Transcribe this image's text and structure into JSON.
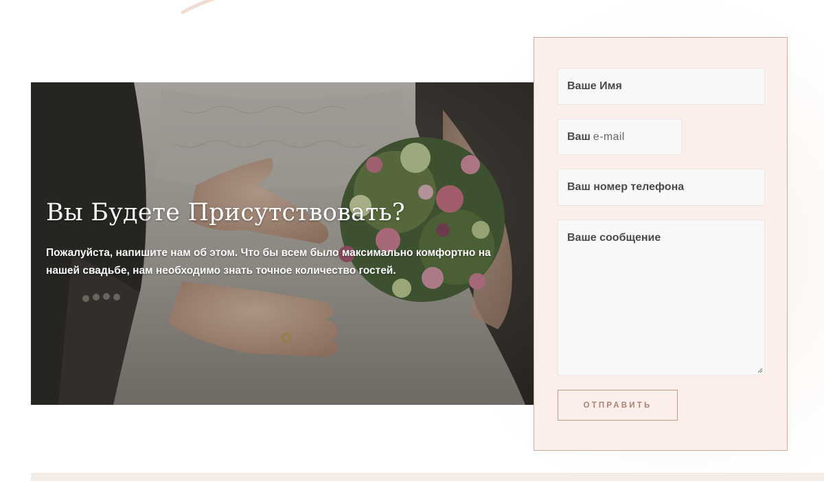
{
  "rsvp": {
    "title": "Вы Будете Присутствовать?",
    "description": "Пожалуйста, напишите нам об этом. Что бы всем было максимально комфортно на нашей свадьбе, нам необходимо знать точное количество гостей."
  },
  "form": {
    "name_placeholder": "Ваше Имя",
    "email_placeholder_bold": "Ваш",
    "email_placeholder_light": "e-mail",
    "phone_placeholder": "Ваш номер телефона",
    "message_placeholder": "Ваше сообщение",
    "submit_label": "ОТПРАВИТЬ"
  },
  "colors": {
    "form_background": "#fbeeeb",
    "form_border": "#c9a99c",
    "accent": "#b0806c",
    "field_background": "#f8f8f8"
  }
}
